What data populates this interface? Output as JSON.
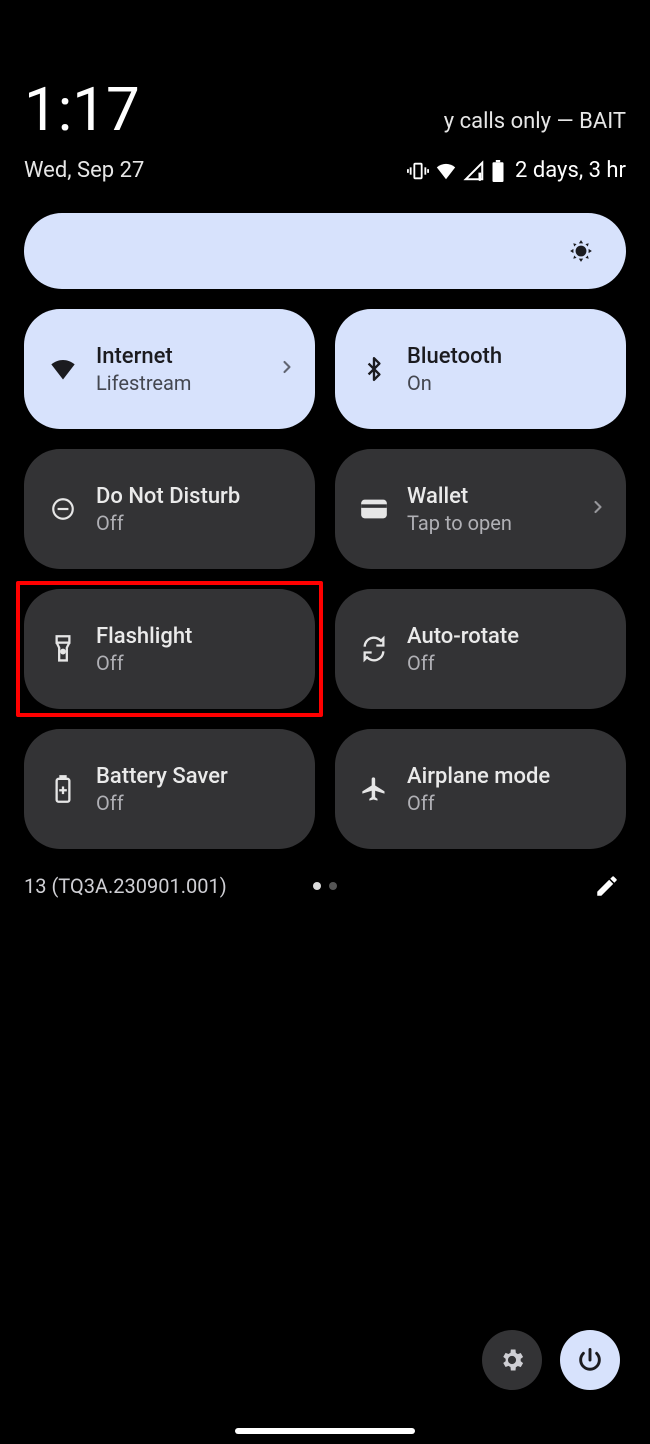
{
  "header": {
    "time": "1:17",
    "date": "Wed, Sep 27",
    "carrier": "y calls only — BAIT",
    "battery_text": "2 days, 3 hr"
  },
  "tiles": [
    {
      "id": "internet",
      "title": "Internet",
      "sub": "Lifestream",
      "on": true,
      "icon": "wifi",
      "chevron": true
    },
    {
      "id": "bluetooth",
      "title": "Bluetooth",
      "sub": "On",
      "on": true,
      "icon": "bluetooth",
      "chevron": false
    },
    {
      "id": "dnd",
      "title": "Do Not Disturb",
      "sub": "Off",
      "on": false,
      "icon": "dnd",
      "chevron": false
    },
    {
      "id": "wallet",
      "title": "Wallet",
      "sub": "Tap to open",
      "on": false,
      "icon": "wallet",
      "chevron": true
    },
    {
      "id": "flashlight",
      "title": "Flashlight",
      "sub": "Off",
      "on": false,
      "icon": "flashlight",
      "chevron": false
    },
    {
      "id": "autorotate",
      "title": "Auto-rotate",
      "sub": "Off",
      "on": false,
      "icon": "rotate",
      "chevron": false
    },
    {
      "id": "battery_saver",
      "title": "Battery Saver",
      "sub": "Off",
      "on": false,
      "icon": "battery",
      "chevron": false
    },
    {
      "id": "airplane",
      "title": "Airplane mode",
      "sub": "Off",
      "on": false,
      "icon": "airplane",
      "chevron": false
    }
  ],
  "highlighted_tile_index": 4,
  "footer": {
    "build": "13 (TQ3A.230901.001)",
    "page_count": 2,
    "active_page": 0
  }
}
